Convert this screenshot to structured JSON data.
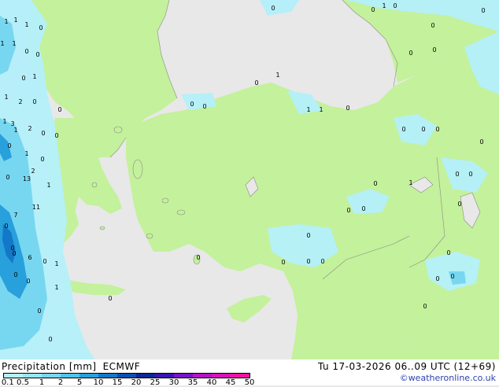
{
  "header": {
    "title": "Precipitation [mm]",
    "model": "ECMWF",
    "valid_time": "Tu 17-03-2026 06..09 UTC (12+69)",
    "credit": "©weatheronline.co.uk"
  },
  "legend": {
    "ticks": [
      "0.1",
      "0.5",
      "1",
      "2",
      "5",
      "10",
      "15",
      "20",
      "25",
      "30",
      "35",
      "40",
      "45",
      "50"
    ],
    "colors": [
      "#b4f0fa",
      "#96e6f5",
      "#78d7f0",
      "#50c3eb",
      "#28a0dc",
      "#1478c8",
      "#0a50b4",
      "#0a2896",
      "#3c14b4",
      "#7814c8",
      "#b414c8",
      "#d714b9",
      "#f014a0"
    ]
  },
  "map_colors": {
    "sea": "#e8e8e8",
    "land": "#c4f19b",
    "precip_light": "#b4f0fa",
    "precip_mid": "#78d7f0",
    "precip_heavy": "#28a0dc",
    "precip_max": "#1478c8"
  },
  "value_labels": [
    "1",
    "1",
    "1",
    "0",
    "1",
    "1",
    "0",
    "0",
    "1",
    "0",
    "1",
    "2",
    "0",
    "0",
    "1",
    "3",
    "2",
    "1",
    "0",
    "0",
    "0",
    "1",
    "0",
    "2",
    "0",
    "13",
    "1",
    "11",
    "7",
    "0",
    "0",
    "0",
    "6",
    "0",
    "1",
    "0",
    "0",
    "1",
    "0",
    "0",
    "0",
    "0",
    "0",
    "0",
    "0",
    "0",
    "0",
    "1",
    "1",
    "1",
    "0",
    "0",
    "1",
    "0",
    "0",
    "0",
    "0",
    "0",
    "0",
    "0",
    "0",
    "0",
    "1",
    "0",
    "0",
    "0",
    "0",
    "0",
    "0",
    "0",
    "0",
    "0",
    "0",
    "0",
    "0",
    "0",
    "0",
    "0",
    "0",
    "0",
    "0",
    "0",
    "0",
    "0",
    "0",
    "0",
    "0"
  ]
}
